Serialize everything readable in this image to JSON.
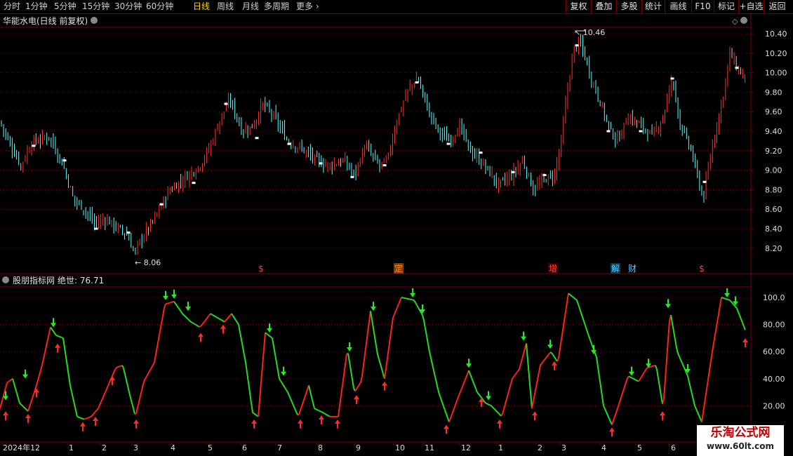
{
  "toolbar": {
    "periods": [
      "分时",
      "1分钟",
      "5分钟",
      "15分钟",
      "30分钟",
      "60分钟",
      "日线",
      "周线",
      "月线",
      "多周期"
    ],
    "active_period": "日线",
    "more": "更多",
    "tools": [
      "复权",
      "叠加",
      "多股",
      "统计",
      "画线",
      "F10",
      "标记",
      "+自选",
      "返回"
    ]
  },
  "main": {
    "title": "华能水电(日线 前复权)",
    "price_axis": [
      "10.40",
      "10.20",
      "10.00",
      "9.80",
      "9.60",
      "9.40",
      "9.20",
      "9.00",
      "8.80",
      "8.60",
      "8.40",
      "8.20"
    ],
    "high_label": "10.46",
    "low_label": "8.06",
    "event_markers": [
      "$",
      "定",
      "增",
      "解",
      "财",
      "$"
    ]
  },
  "indicator": {
    "name": "股朋指标网",
    "value_label": "绝世: 76.71",
    "axis": [
      "100.0",
      "80.00",
      "60.00",
      "40.00",
      "20.00"
    ]
  },
  "time_axis": [
    "2024年12",
    "1",
    "2",
    "3",
    "4",
    "5",
    "6",
    "7",
    "8",
    "9",
    "10",
    "11",
    "12",
    "1",
    "2",
    "3",
    "4",
    "5",
    "6"
  ],
  "colors": {
    "up": "#ff3232",
    "down": "#54ffff",
    "osc_up": "#ff2020",
    "osc_down": "#22dd22",
    "grid": "#7a0000",
    "axis_text": "#dcdcdc"
  },
  "watermark": {
    "line1": "乐淘公式网",
    "line2": "www.60lt.com"
  }
}
